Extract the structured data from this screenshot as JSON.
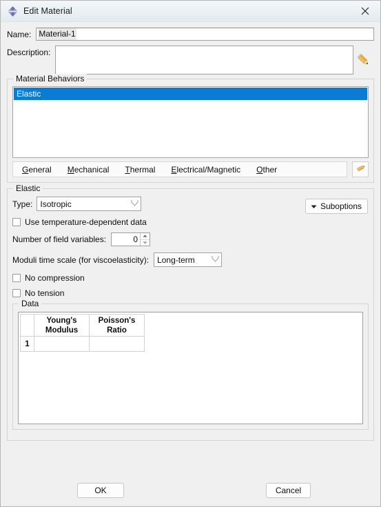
{
  "window": {
    "title": "Edit Material",
    "icon": "abaqus-material-icon",
    "close_label": "✕"
  },
  "form": {
    "name_label": "Name:",
    "name_value": "Material-1",
    "description_label": "Description:",
    "description_value": "",
    "description_edit_icon": "pencil-icon"
  },
  "material_behaviors": {
    "group_title": "Material Behaviors",
    "items": [
      {
        "label": "Elastic",
        "selected": true
      }
    ],
    "menu": [
      {
        "label": "General",
        "mnemonic": "G",
        "rest": "eneral"
      },
      {
        "label": "Mechanical",
        "mnemonic": "M",
        "rest": "echanical"
      },
      {
        "label": "Thermal",
        "mnemonic": "T",
        "rest": "hermal"
      },
      {
        "label": "Electrical/Magnetic",
        "mnemonic": "E",
        "rest": "lectrical/Magnetic"
      },
      {
        "label": "Other",
        "mnemonic": "O",
        "rest": "ther"
      }
    ],
    "edit_icon": "pencil-icon",
    "selection_color": "#0a7cd4"
  },
  "elastic": {
    "group_title": "Elastic",
    "type_label": "Type:",
    "type_value": "Isotropic",
    "suboptions_label": "Suboptions",
    "suboptions_arrow": "▼",
    "temperature_dependent_label": "Use temperature-dependent data",
    "temperature_dependent_checked": false,
    "field_variables_label": "Number of field variables:",
    "field_variables_value": "0",
    "moduli_label": "Moduli time scale (for viscoelasticity):",
    "moduli_value": "Long-term",
    "no_compression_label": "No compression",
    "no_compression_checked": false,
    "no_tension_label": "No tension",
    "no_tension_checked": false
  },
  "data": {
    "group_title": "Data",
    "columns": [
      "",
      "Young's\nModulus",
      "Poisson's\nRatio"
    ],
    "column_line1": [
      "",
      "Young's",
      "Poisson's"
    ],
    "column_line2": [
      "",
      "Modulus",
      "Ratio"
    ],
    "rows": [
      {
        "index": "1",
        "youngs_modulus": "",
        "poissons_ratio": ""
      }
    ]
  },
  "footer": {
    "ok_label": "OK",
    "cancel_label": "Cancel"
  }
}
